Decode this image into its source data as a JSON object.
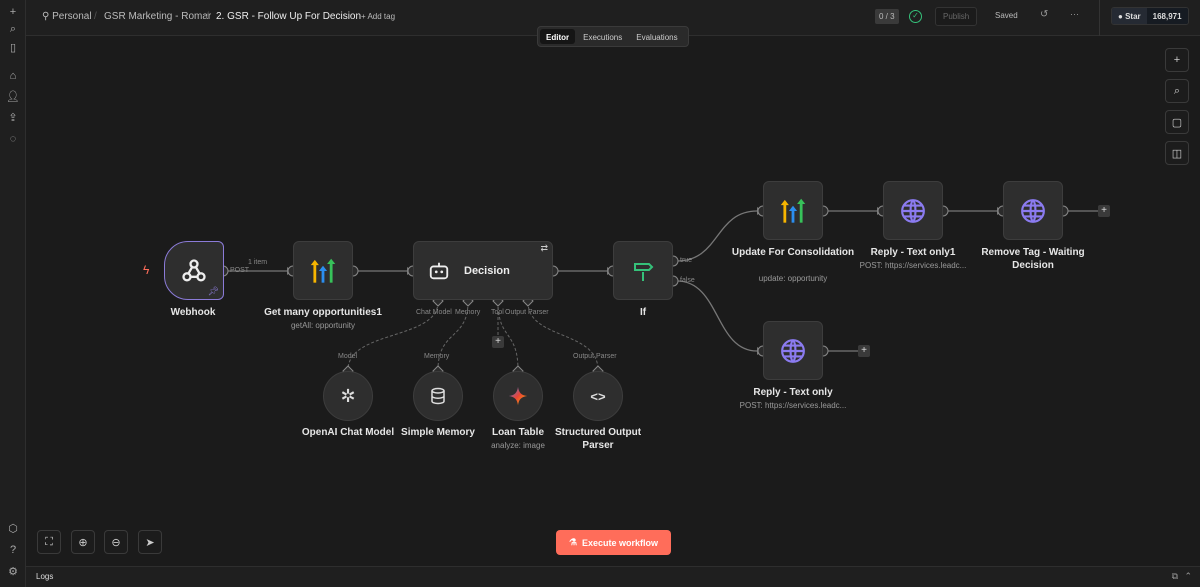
{
  "header": {
    "breadcrumb": [
      "Personal",
      "GSR Marketing - Romar",
      "2. GSR - Follow Up For Decision"
    ],
    "add_tag": "+ Add tag",
    "counter": "0 / 3",
    "publish": "Publish",
    "saved": "Saved",
    "more": "···",
    "github_star": "Star",
    "github_count": "168,971"
  },
  "tabs": [
    "Editor",
    "Executions",
    "Evaluations"
  ],
  "nodes": {
    "webhook": {
      "label": "Webhook",
      "out": "POST"
    },
    "getmany": {
      "label": "Get many opportunities1",
      "sub": "getAll: opportunity"
    },
    "decision": {
      "label": "Decision",
      "ports": [
        "Chat Model",
        "Memory",
        "Tool",
        "Output Parser"
      ]
    },
    "if": {
      "label": "If",
      "true": "true",
      "false": "false"
    },
    "update": {
      "label": "Update For Consolidation",
      "sub": "update: opportunity"
    },
    "reply1": {
      "label": "Reply - Text only1",
      "sub": "POST: https://services.leadc..."
    },
    "remove": {
      "label": "Remove Tag - Waiting Decision"
    },
    "reply": {
      "label": "Reply - Text only",
      "sub": "POST: https://services.leadc..."
    },
    "openai": {
      "label": "OpenAI Chat Model",
      "port": "Model"
    },
    "memory": {
      "label": "Simple Memory",
      "port": "Memory"
    },
    "loan": {
      "label": "Loan Table",
      "sub": "analyze: image"
    },
    "parser": {
      "label": "Structured Output Parser",
      "port": "Output Parser"
    }
  },
  "edge_label": "1 item",
  "execute": "Execute workflow",
  "logs": "Logs",
  "colors": {
    "accent": "#ff6d5a",
    "webhook_border": "#8b7bd8",
    "globe": "#8b7bf0",
    "if": "#35c17a"
  }
}
